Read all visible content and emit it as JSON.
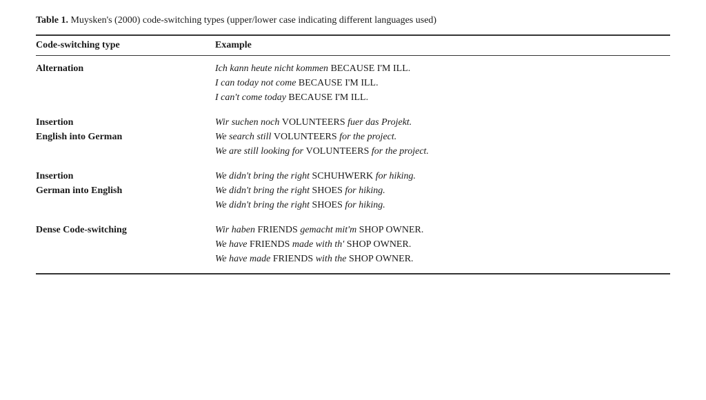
{
  "caption": {
    "bold": "Table 1.",
    "text": "  Muysken's (2000) code-switching types (upper/lower case indicating different languages used)"
  },
  "columns": {
    "col1": "Code-switching type",
    "col2": "Example"
  },
  "rows": [
    {
      "id": "alternation",
      "type_line1": "Alternation",
      "type_line2": "",
      "examples": [
        "Ich kann heute nicht kommen BECAUSE I'M ILL.",
        "I can today not come BECAUSE I'M ILL.",
        "I can't come today BECAUSE I'M ILL."
      ]
    },
    {
      "id": "insertion-eng-ger",
      "type_line1": "Insertion",
      "type_line2": "English into German",
      "examples": [
        "Wir suchen noch VOLUNTEERS fuer das Projekt.",
        "We search still VOLUNTEERS for the project.",
        "We are still looking for VOLUNTEERS for the project."
      ]
    },
    {
      "id": "insertion-ger-eng",
      "type_line1": "Insertion",
      "type_line2": "German into English",
      "examples": [
        "We didn't bring the right SCHUHWERK for hiking.",
        "We didn't bring the right SHOES for hiking.",
        "We didn't bring the right SHOES for hiking."
      ]
    },
    {
      "id": "dense-code-switching",
      "type_line1": "Dense Code-switching",
      "type_line2": "",
      "examples": [
        "Wir haben FRIENDS gemacht mit'm SHOP OWNER.",
        "We have FRIENDS made with th' SHOP OWNER.",
        "We have made FRIENDS with the SHOP OWNER."
      ]
    }
  ]
}
